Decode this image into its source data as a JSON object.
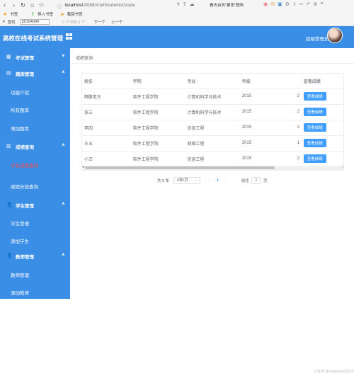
{
  "browser": {
    "url_host": "localhost",
    "url_path": ":8088/#/allStudentsGrade",
    "promo": "看去台风\"暴雨\"登陆",
    "bookmarks": [
      "书签",
      "导入书签",
      "我回书签"
    ],
    "find": {
      "label": "查找",
      "value": "20154084",
      "result": "0 个中的 0 个",
      "next": "下一个",
      "prev": "上一个"
    }
  },
  "header": {
    "title": "高校在线考试系统管理",
    "admin_label": "超级管理员"
  },
  "sidebar": {
    "groups": [
      {
        "label": "考试管理",
        "icon": "calendar-icon",
        "arrow": "∨"
      },
      {
        "label": "题库管理",
        "icon": "document-icon",
        "arrow": "∧",
        "items": [
          "功能介绍",
          "所有题库",
          "增加题库"
        ]
      },
      {
        "label": "成绩查询",
        "icon": "chart-icon",
        "arrow": "∧",
        "items": [
          "学生成绩查询",
          "成绩分段查询"
        ]
      },
      {
        "label": "学生管理",
        "icon": "user-icon",
        "arrow": "∧",
        "items": [
          "学生管理",
          "添加学生"
        ]
      },
      {
        "label": "教师管理",
        "icon": "user-icon",
        "arrow": "∧",
        "items": [
          "教师管理",
          "添加教师"
        ]
      }
    ]
  },
  "breadcrumb": "成绩查询",
  "table": {
    "headers": [
      "姓名",
      "学院",
      "专业",
      "年级",
      "",
      "查看成绩"
    ],
    "rows": [
      [
        "隔壁老王",
        "软件工程学院",
        "计算机科学与技术",
        "2015",
        "2",
        "查看成绩"
      ],
      [
        "张三",
        "软件工程学院",
        "计算机科学与技术",
        "2015",
        "2",
        "查看成绩"
      ],
      [
        "李四",
        "软件工程学院",
        "信息工程",
        "2015",
        "2",
        "查看成绩"
      ],
      [
        "王五",
        "软件工程学院",
        "网络工程",
        "2015",
        "1",
        "查看成绩"
      ],
      [
        "小王",
        "软件工程学院",
        "信息工程",
        "2015",
        "2",
        "查看成绩"
      ]
    ]
  },
  "pagination": {
    "total": "共 5 条",
    "page_size": "6条/页",
    "current": "1",
    "goto_label": "前往",
    "goto_value": "1",
    "unit": "页"
  },
  "watermark": "CSDN @codemode2022"
}
